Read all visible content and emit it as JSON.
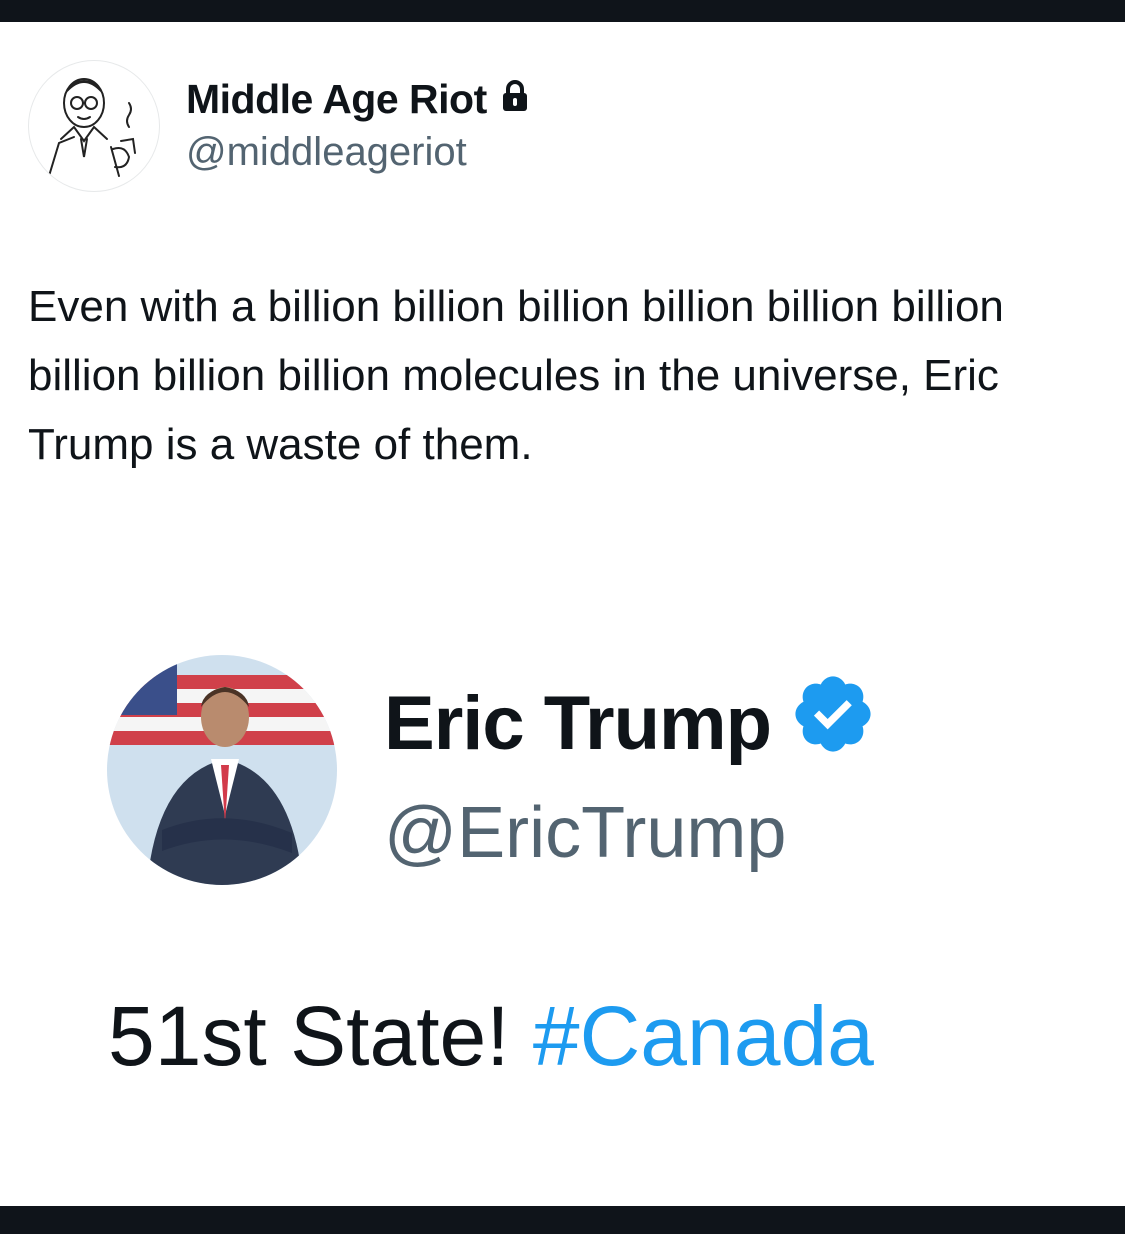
{
  "tweet": {
    "author": {
      "display_name": "Middle Age Riot",
      "handle": "@middleageriot",
      "protected_icon": "lock-icon",
      "avatar_icon": "vintage-man-with-pipe-illustration"
    },
    "text": "Even with a billion billion billion billion billion billion billion billion billion molecules in the universe, Eric Trump is a waste of them."
  },
  "embedded": {
    "author": {
      "display_name": "Eric Trump",
      "handle": "@EricTrump",
      "verified_icon": "verified-badge-icon"
    },
    "text_prefix": "51st State! ",
    "hashtag": "#Canada"
  },
  "colors": {
    "text_primary": "#0f1419",
    "text_secondary": "#536471",
    "link": "#1d9bf0",
    "verified": "#1d9bf0",
    "frame_bars": "#0f141a"
  }
}
